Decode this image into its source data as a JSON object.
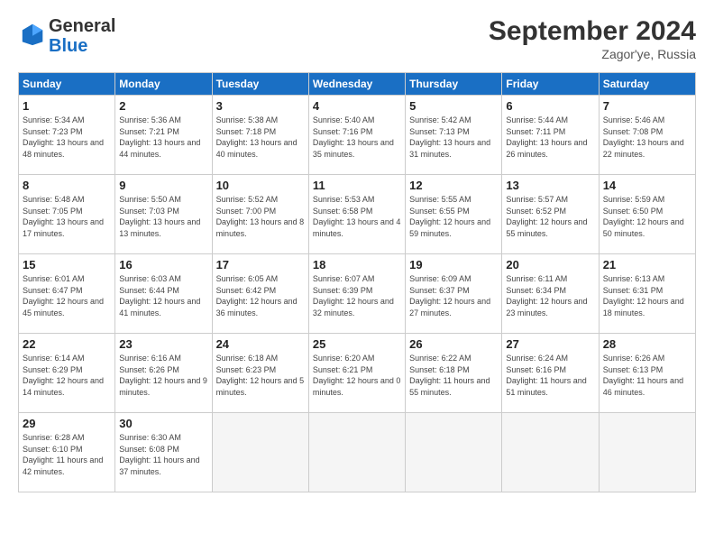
{
  "logo": {
    "general": "General",
    "blue": "Blue"
  },
  "title": "September 2024",
  "location": "Zagor'ye, Russia",
  "days_header": [
    "Sunday",
    "Monday",
    "Tuesday",
    "Wednesday",
    "Thursday",
    "Friday",
    "Saturday"
  ],
  "weeks": [
    [
      {
        "day": "1",
        "sunrise": "5:34 AM",
        "sunset": "7:23 PM",
        "daylight": "13 hours and 48 minutes."
      },
      {
        "day": "2",
        "sunrise": "5:36 AM",
        "sunset": "7:21 PM",
        "daylight": "13 hours and 44 minutes."
      },
      {
        "day": "3",
        "sunrise": "5:38 AM",
        "sunset": "7:18 PM",
        "daylight": "13 hours and 40 minutes."
      },
      {
        "day": "4",
        "sunrise": "5:40 AM",
        "sunset": "7:16 PM",
        "daylight": "13 hours and 35 minutes."
      },
      {
        "day": "5",
        "sunrise": "5:42 AM",
        "sunset": "7:13 PM",
        "daylight": "13 hours and 31 minutes."
      },
      {
        "day": "6",
        "sunrise": "5:44 AM",
        "sunset": "7:11 PM",
        "daylight": "13 hours and 26 minutes."
      },
      {
        "day": "7",
        "sunrise": "5:46 AM",
        "sunset": "7:08 PM",
        "daylight": "13 hours and 22 minutes."
      }
    ],
    [
      {
        "day": "8",
        "sunrise": "5:48 AM",
        "sunset": "7:05 PM",
        "daylight": "13 hours and 17 minutes."
      },
      {
        "day": "9",
        "sunrise": "5:50 AM",
        "sunset": "7:03 PM",
        "daylight": "13 hours and 13 minutes."
      },
      {
        "day": "10",
        "sunrise": "5:52 AM",
        "sunset": "7:00 PM",
        "daylight": "13 hours and 8 minutes."
      },
      {
        "day": "11",
        "sunrise": "5:53 AM",
        "sunset": "6:58 PM",
        "daylight": "13 hours and 4 minutes."
      },
      {
        "day": "12",
        "sunrise": "5:55 AM",
        "sunset": "6:55 PM",
        "daylight": "12 hours and 59 minutes."
      },
      {
        "day": "13",
        "sunrise": "5:57 AM",
        "sunset": "6:52 PM",
        "daylight": "12 hours and 55 minutes."
      },
      {
        "day": "14",
        "sunrise": "5:59 AM",
        "sunset": "6:50 PM",
        "daylight": "12 hours and 50 minutes."
      }
    ],
    [
      {
        "day": "15",
        "sunrise": "6:01 AM",
        "sunset": "6:47 PM",
        "daylight": "12 hours and 45 minutes."
      },
      {
        "day": "16",
        "sunrise": "6:03 AM",
        "sunset": "6:44 PM",
        "daylight": "12 hours and 41 minutes."
      },
      {
        "day": "17",
        "sunrise": "6:05 AM",
        "sunset": "6:42 PM",
        "daylight": "12 hours and 36 minutes."
      },
      {
        "day": "18",
        "sunrise": "6:07 AM",
        "sunset": "6:39 PM",
        "daylight": "12 hours and 32 minutes."
      },
      {
        "day": "19",
        "sunrise": "6:09 AM",
        "sunset": "6:37 PM",
        "daylight": "12 hours and 27 minutes."
      },
      {
        "day": "20",
        "sunrise": "6:11 AM",
        "sunset": "6:34 PM",
        "daylight": "12 hours and 23 minutes."
      },
      {
        "day": "21",
        "sunrise": "6:13 AM",
        "sunset": "6:31 PM",
        "daylight": "12 hours and 18 minutes."
      }
    ],
    [
      {
        "day": "22",
        "sunrise": "6:14 AM",
        "sunset": "6:29 PM",
        "daylight": "12 hours and 14 minutes."
      },
      {
        "day": "23",
        "sunrise": "6:16 AM",
        "sunset": "6:26 PM",
        "daylight": "12 hours and 9 minutes."
      },
      {
        "day": "24",
        "sunrise": "6:18 AM",
        "sunset": "6:23 PM",
        "daylight": "12 hours and 5 minutes."
      },
      {
        "day": "25",
        "sunrise": "6:20 AM",
        "sunset": "6:21 PM",
        "daylight": "12 hours and 0 minutes."
      },
      {
        "day": "26",
        "sunrise": "6:22 AM",
        "sunset": "6:18 PM",
        "daylight": "11 hours and 55 minutes."
      },
      {
        "day": "27",
        "sunrise": "6:24 AM",
        "sunset": "6:16 PM",
        "daylight": "11 hours and 51 minutes."
      },
      {
        "day": "28",
        "sunrise": "6:26 AM",
        "sunset": "6:13 PM",
        "daylight": "11 hours and 46 minutes."
      }
    ],
    [
      {
        "day": "29",
        "sunrise": "6:28 AM",
        "sunset": "6:10 PM",
        "daylight": "11 hours and 42 minutes."
      },
      {
        "day": "30",
        "sunrise": "6:30 AM",
        "sunset": "6:08 PM",
        "daylight": "11 hours and 37 minutes."
      },
      null,
      null,
      null,
      null,
      null
    ]
  ]
}
